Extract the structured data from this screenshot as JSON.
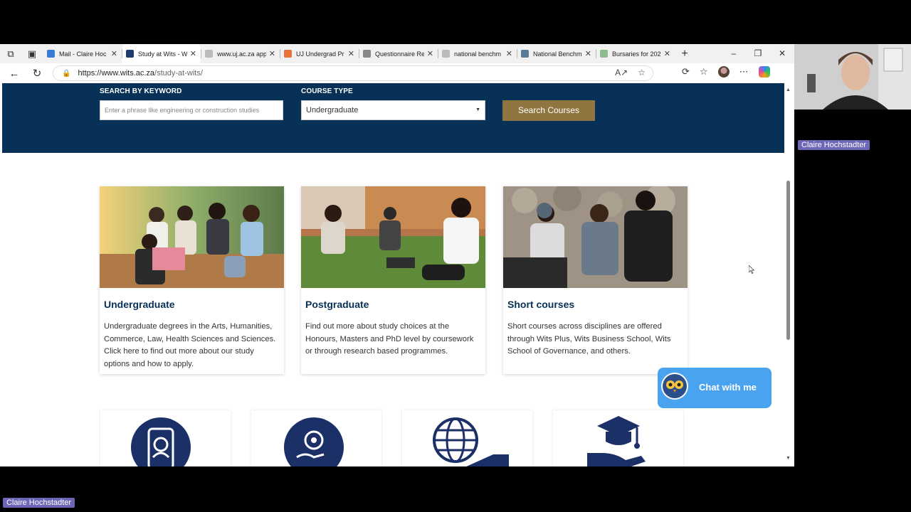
{
  "tabs": [
    {
      "label": "Mail - Claire Hoc",
      "fav": "#3a7bd5",
      "active": false
    },
    {
      "label": "Study at Wits - W",
      "fav": "#1e3c72",
      "active": true
    },
    {
      "label": "www.uj.ac.za app",
      "fav": "#bbbbbb",
      "active": false
    },
    {
      "label": "UJ Undergrad Pr",
      "fav": "#e8733a",
      "active": false
    },
    {
      "label": "Questionnaire Re",
      "fav": "#888888",
      "active": false
    },
    {
      "label": "national benchm",
      "fav": "#bbbbbb",
      "active": false
    },
    {
      "label": "National Benchm",
      "fav": "#5a7a9a",
      "active": false
    },
    {
      "label": "Bursaries for 202",
      "fav": "#8fbc8f",
      "active": false
    }
  ],
  "address": {
    "host": "https://www.wits.ac.za",
    "path": "/study-at-wits/"
  },
  "search": {
    "keyword_label": "SEARCH BY KEYWORD",
    "keyword_placeholder": "Enter a phrase like engineering or construction studies",
    "course_label": "COURSE TYPE",
    "course_value": "Undergraduate",
    "button_label": "Search Courses"
  },
  "cards": [
    {
      "title": "Undergraduate",
      "text": "Undergraduate degrees in the Arts, Humanities, Commerce, Law, Health Sciences and Sciences. Click here to find out more about our study options and how to apply."
    },
    {
      "title": "Postgraduate",
      "text": "Find out more about study choices at the Honours, Masters and PhD level by coursework or through research based programmes."
    },
    {
      "title": "Short courses",
      "text": "Short courses across disciplines are offered through Wits Plus, Wits Business School, Wits School of Governance, and others."
    }
  ],
  "icon_tiles": [
    "mobile-profile-icon",
    "gear-hand-icon",
    "globe-hand-icon",
    "graduation-cap-hand-icon"
  ],
  "chat": {
    "label": "Chat with me"
  },
  "participants": {
    "camera_name": "Claire Hochstadter",
    "screen_name": "Claire Hochstadter"
  },
  "colors": {
    "brand_navy": "#073157",
    "button_gold": "#8f7540",
    "chat_blue": "#4aa3ef",
    "icon_navy": "#1c3068"
  }
}
